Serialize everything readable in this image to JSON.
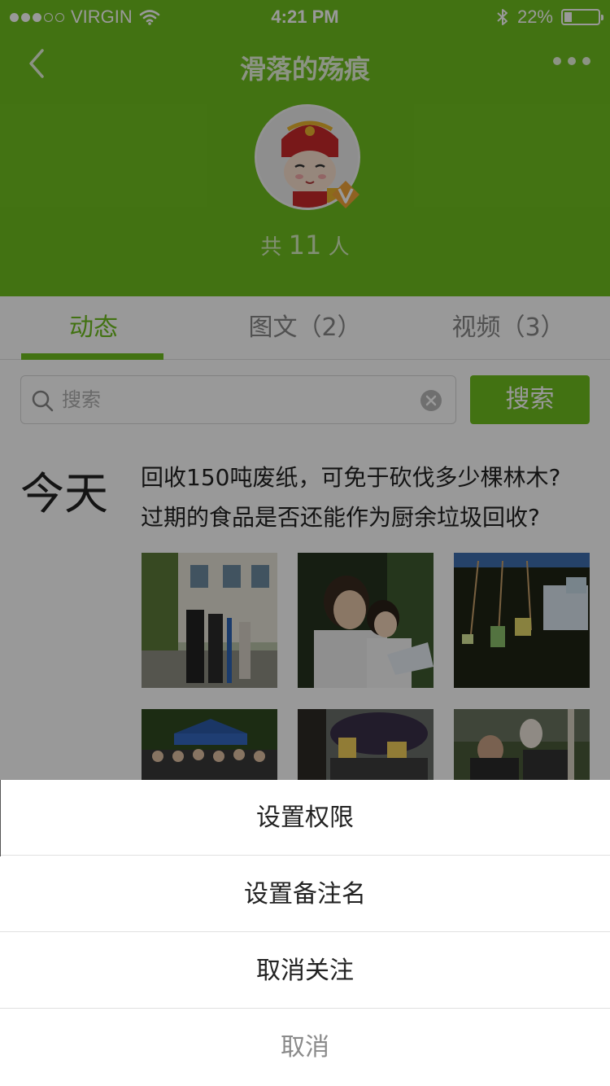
{
  "status_bar": {
    "carrier": "VIRGIN",
    "time": "4:21 PM",
    "battery": "22%",
    "battery_level": 0.22,
    "signal_bars": 3,
    "signal_total": 5
  },
  "header": {
    "title": "滑落的殇痕",
    "member_prefix": "共",
    "member_count": "11",
    "member_suffix": "人",
    "colors": {
      "brand": "#6fbf1f"
    }
  },
  "tabs": [
    {
      "label": "动态",
      "active": true
    },
    {
      "label": "图文（2）",
      "active": false
    },
    {
      "label": "视频（3）",
      "active": false
    }
  ],
  "search": {
    "placeholder": "搜索",
    "button_label": "搜索"
  },
  "feed": {
    "day_label": "今天",
    "post_line1": "回收150吨废纸，可免于砍伐多少棵林木?",
    "post_line2": "过期的食品是否还能作为厨余垃圾回收?"
  },
  "action_sheet": {
    "items": [
      "设置权限",
      "设置备注名",
      "取消关注"
    ],
    "cancel_label": "取消"
  },
  "icons": {
    "back": "chevron-left-icon",
    "more": "ellipsis-icon",
    "search": "magnifier-icon",
    "clear": "clear-circle-icon",
    "wifi": "wifi-icon",
    "bluetooth": "bluetooth-icon",
    "verified": "verified-v-icon"
  }
}
